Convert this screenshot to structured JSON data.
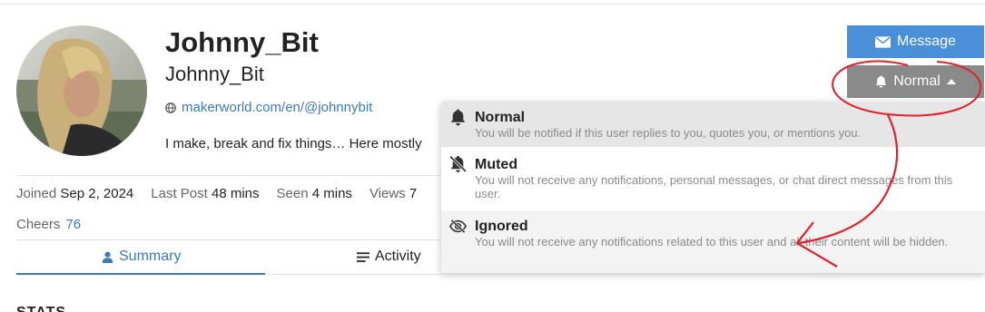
{
  "profile": {
    "name": "Johnny_Bit",
    "username": "Johnny_Bit",
    "website": "makerworld.com/en/@johnnybit",
    "bio": "I make, break and fix things… Here mostly"
  },
  "stats": {
    "joined_label": "Joined",
    "joined_value": "Sep 2, 2024",
    "last_post_label": "Last Post",
    "last_post_value": "48 mins",
    "seen_label": "Seen",
    "seen_value": "4 mins",
    "views_label": "Views",
    "views_value": "7",
    "cheers_label": "Cheers",
    "cheers_value": "76"
  },
  "tabs": [
    {
      "label": "Summary",
      "icon": "user-icon",
      "active": true
    },
    {
      "label": "Activity",
      "icon": "list-icon",
      "active": false
    }
  ],
  "section_title": "STATS",
  "buttons": {
    "message_label": "Message",
    "notification_label": "Normal"
  },
  "notification_menu": [
    {
      "title": "Normal",
      "description": "You will be notified if this user replies to you, quotes you, or mentions you.",
      "icon": "bell-icon",
      "selected": true
    },
    {
      "title": "Muted",
      "description": "You will not receive any notifications, personal messages, or chat direct messages from this user.",
      "icon": "bell-slash-icon",
      "selected": false
    },
    {
      "title": "Ignored",
      "description": "You will not receive any notifications related to this user and all their content will be hidden.",
      "icon": "eye-slash-icon",
      "selected": false
    }
  ],
  "colors": {
    "accent": "#3d7ab8",
    "message_button": "#4a90d9",
    "notification_button": "#8a8a8a",
    "annotation": "#e0202a"
  }
}
